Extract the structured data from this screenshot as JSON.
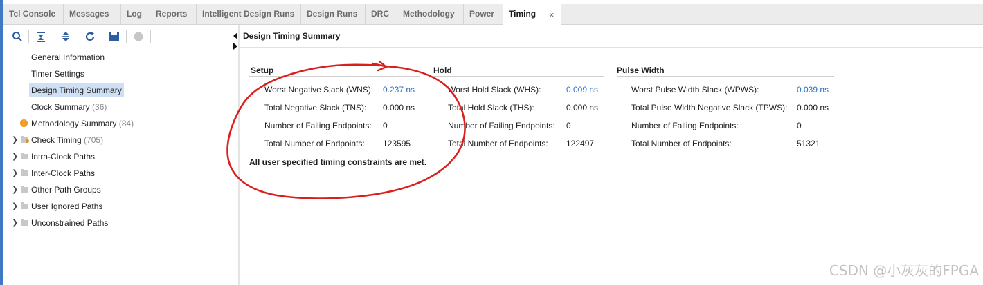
{
  "tabs": [
    {
      "label": "Tcl Console"
    },
    {
      "label": "Messages"
    },
    {
      "label": "Log"
    },
    {
      "label": "Reports"
    },
    {
      "label": "Intelligent Design Runs"
    },
    {
      "label": "Design Runs"
    },
    {
      "label": "DRC"
    },
    {
      "label": "Methodology"
    },
    {
      "label": "Power"
    },
    {
      "label": "Timing"
    }
  ],
  "active_tab": "Timing",
  "close_glyph": "×",
  "toolbar": {
    "icons": [
      "search-icon",
      "collapse-all-icon",
      "expand-all-icon",
      "refresh-icon",
      "save-icon",
      "stop-icon"
    ]
  },
  "tree": {
    "general_information": "General Information",
    "timer_settings": "Timer Settings",
    "design_timing_summary": "Design Timing Summary",
    "clock_summary": {
      "label": "Clock Summary",
      "count": "(36)"
    },
    "methodology_summary": {
      "label": "Methodology Summary",
      "count": "(84)"
    },
    "check_timing": {
      "label": "Check Timing",
      "count": "(705)"
    },
    "intra_clock_paths": "Intra-Clock Paths",
    "inter_clock_paths": "Inter-Clock Paths",
    "other_path_groups": "Other Path Groups",
    "user_ignored_paths": "User Ignored Paths",
    "unconstrained_paths": "Unconstrained Paths"
  },
  "panel": {
    "title": "Design Timing Summary",
    "setup": {
      "heading": "Setup",
      "rows": [
        {
          "label": "Worst Negative Slack (WNS):",
          "value": "0.237 ns"
        },
        {
          "label": "Total Negative Slack (TNS):",
          "value": "0.000 ns"
        },
        {
          "label": "Number of Failing Endpoints:",
          "value": "0"
        },
        {
          "label": "Total Number of Endpoints:",
          "value": "123595"
        }
      ]
    },
    "hold": {
      "heading": "Hold",
      "rows": [
        {
          "label": "Worst Hold Slack (WHS):",
          "value": "0.009 ns"
        },
        {
          "label": "Total Hold Slack (THS):",
          "value": "0.000 ns"
        },
        {
          "label": "Number of Failing Endpoints:",
          "value": "0"
        },
        {
          "label": "Total Number of Endpoints:",
          "value": "122497"
        }
      ]
    },
    "pulse_width": {
      "heading": "Pulse Width",
      "rows": [
        {
          "label": "Worst Pulse Width Slack (WPWS):",
          "value": "0.039 ns"
        },
        {
          "label": "Total Pulse Width Negative Slack (TPWS):",
          "value": "0.000 ns"
        },
        {
          "label": "Number of Failing Endpoints:",
          "value": "0"
        },
        {
          "label": "Total Number of Endpoints:",
          "value": "51321"
        }
      ]
    },
    "status_message": "All user specified timing constraints are met."
  },
  "colors": {
    "link": "#2a6fc9",
    "selection": "#cfe0f5",
    "annotation": "#d9201c",
    "edge": "#3f79c6"
  },
  "watermark": "CSDN @小灰灰的FPGA"
}
